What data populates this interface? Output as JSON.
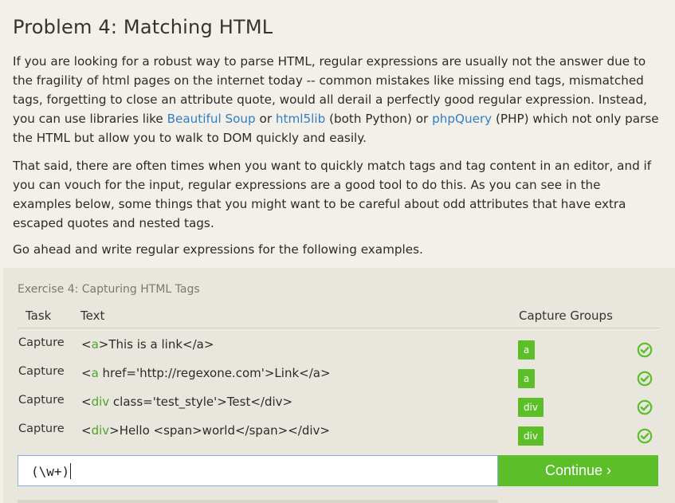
{
  "heading": "Problem 4: Matching HTML",
  "p1": {
    "t1": "If you are looking for a robust way to parse HTML, regular expressions are usually not the answer due to the fragility of html pages on the internet today -- common mistakes like missing end tags, mismatched tags, forgetting to close an attribute quote, would all derail a perfectly good regular expression. Instead, you can use libraries like ",
    "link1": "Beautiful Soup",
    "t2": " or ",
    "link2": "html5lib",
    "t3": " (both Python) or ",
    "link3": "phpQuery",
    "t4": " (PHP) which not only parse the HTML but allow you to walk to DOM quickly and easily."
  },
  "p2": "That said, there are often times when you want to quickly match tags and tag content in an editor, and if you can vouch for the input, regular expressions are a good tool to do this. As you can see in the examples below, some things that you might want to be careful about odd attributes that have extra escaped quotes and nested tags.",
  "p3": "Go ahead and write regular expressions for the following examples.",
  "exercise": {
    "title": "Exercise 4: Capturing HTML Tags",
    "headers": {
      "task": "Task",
      "text": "Text",
      "groups": "Capture Groups"
    },
    "rows": [
      {
        "task": "Capture",
        "pre": "<",
        "tag": "a",
        "post": ">This is a link</a>",
        "group": "a",
        "status": "check-circle-icon"
      },
      {
        "task": "Capture",
        "pre": "<",
        "tag": "a",
        "post": " href='http://regexone.com'>Link</a>",
        "group": "a",
        "status": "check-circle-icon"
      },
      {
        "task": "Capture",
        "pre": "<",
        "tag": "div",
        "post": " class='test_style'>Test</div>",
        "group": "div",
        "status": "check-circle-icon"
      },
      {
        "task": "Capture",
        "pre": "<",
        "tag": "div",
        "post": ">Hello <span>world</span></div>",
        "group": "div",
        "status": "check-circle-icon"
      }
    ],
    "input_value": "(\\w+)",
    "continue_label": "Continue ›"
  },
  "colors": {
    "accent": "#5cbf2a",
    "link": "#2f7ec6",
    "panel": "#e8e6dd"
  }
}
